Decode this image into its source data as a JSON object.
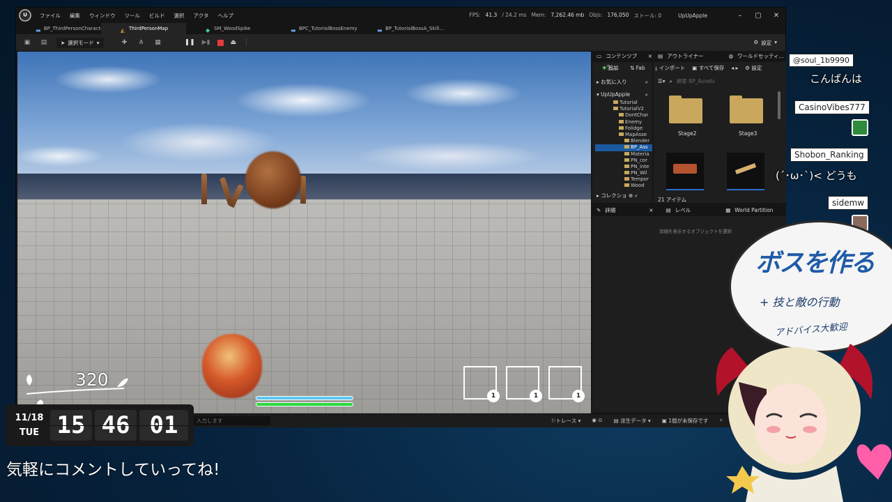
{
  "window": {
    "menu": [
      "ファイル",
      "編集",
      "ウィンドウ",
      "ツール",
      "ビルド",
      "選択",
      "アクタ",
      "ヘルプ"
    ],
    "stats": {
      "fps_label": "FPS:",
      "fps": "41.3",
      "ms": "/ 24.2 ms",
      "mem_label": "Mem:",
      "mem": "7,262.46 mb",
      "objects_label": "Objs:",
      "objects": "176,050",
      "stalls": "ストール: 0"
    },
    "project": "UpUpApple",
    "controls": [
      "–",
      "▢",
      "✕"
    ]
  },
  "tabs": [
    {
      "label": "BP_ThirdPersonCharacter",
      "icon": "blueprint-icon"
    },
    {
      "label": "ThirdPersonMap",
      "icon": "map-icon",
      "active": true
    },
    {
      "label": "SM_WoodSpike",
      "icon": "mesh-icon"
    },
    {
      "label": "BPC_TutorialBossEnemy",
      "icon": "blueprint-icon"
    },
    {
      "label": "BP_TutorialBossA_Skill...",
      "icon": "blueprint-icon"
    }
  ],
  "toolbar": {
    "mode": "選択モード",
    "settings": "設定"
  },
  "viewport": {
    "slots": [
      "1",
      "1",
      "1"
    ],
    "hp": 1.0,
    "stamina": 1.0
  },
  "statusbar": {
    "cmd_placeholder": "入力します",
    "trace": "トレース",
    "derived": "派生データ",
    "unsaved": "1個が未保存です"
  },
  "content_browser": {
    "title": "コンテンツブラ...",
    "add": "追加",
    "fab": "Fab",
    "import": "インポート",
    "save_all": "すべて保存",
    "settings": "設定",
    "favorites": "お気に入り",
    "project": "UpUpApple",
    "tree": [
      "Tutorial",
      "TutorialV2",
      "DontChar",
      "Enemy",
      "Folidge",
      "MapAsse",
      "Blender",
      "BP_Ass",
      "Materia",
      "PN_cor",
      "PN_inte",
      "PN_Wil",
      "Tempor",
      "Wood"
    ],
    "collections": "コレクショ",
    "search_placeholder": "検索 BP_Assets",
    "items": [
      "Stage2",
      "Stage3"
    ],
    "count": "21 アイテム"
  },
  "outliner": {
    "title": "アウトライナー",
    "world": "ワールドセッティ..."
  },
  "details": {
    "title": "詳細",
    "level": "レベル",
    "world_partition": "World Partition",
    "hint": "詳細を表示するオブジェクトを選択"
  },
  "chat": [
    {
      "name": "@soul_1b9990",
      "text": "こんばんは"
    },
    {
      "name": "CasinoVibes777",
      "text": ""
    },
    {
      "name": "Shobon_Ranking",
      "text": "(´･ω･`)< どうも"
    },
    {
      "name": "sidemw",
      "text": ""
    }
  ],
  "bubble": {
    "title": "ボスを作る",
    "line1": "+ 技と敵の行動",
    "line2": "アドバイス大歓迎"
  },
  "overlay": {
    "score": "320",
    "date": "11/18",
    "weekday": "TUE",
    "hour": "15",
    "minute": "46",
    "second": "01",
    "message": "気軽にコメントしていってね!"
  }
}
